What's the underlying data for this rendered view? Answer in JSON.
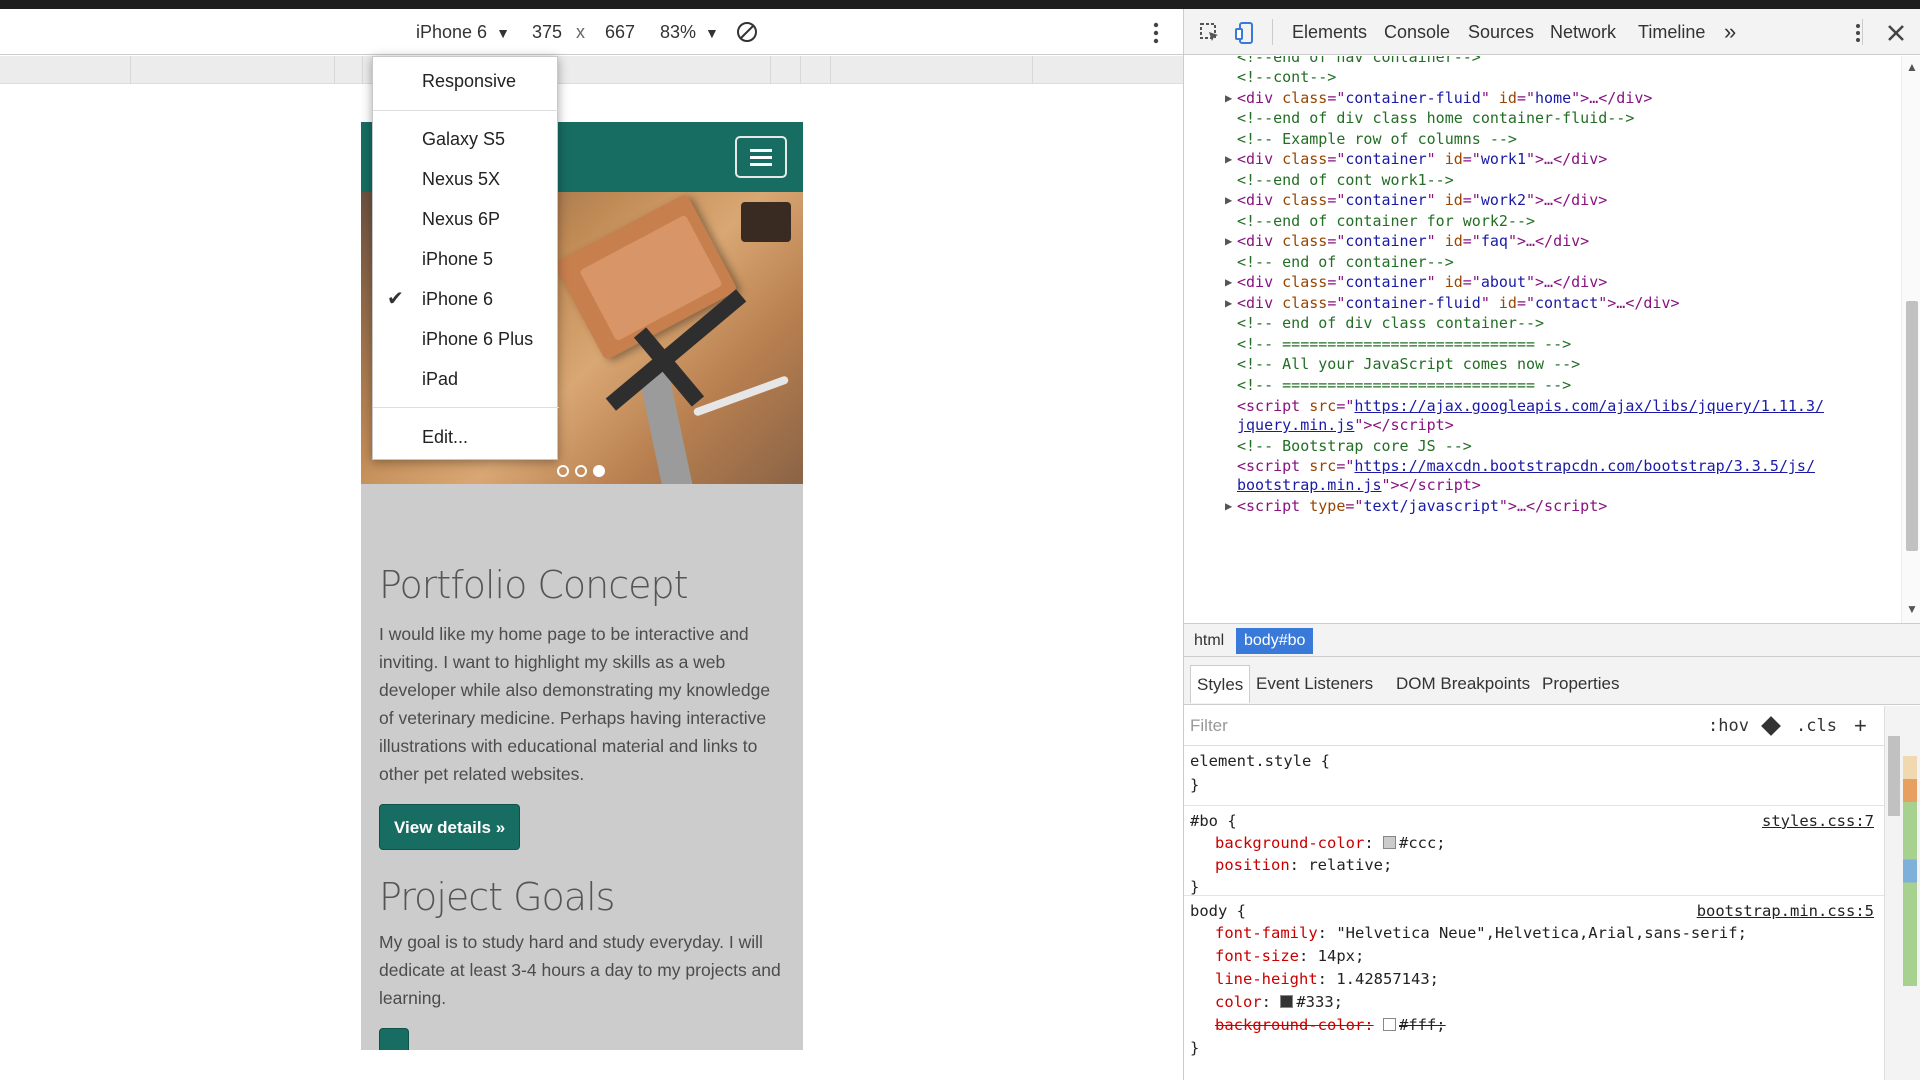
{
  "device_toolbar": {
    "device": "iPhone 6",
    "caret": "▼",
    "width": "375",
    "times": "x",
    "height": "667",
    "zoom": "83%"
  },
  "device_menu": {
    "items": [
      "Responsive",
      "Galaxy S5",
      "Nexus 5X",
      "Nexus 6P",
      "iPhone 5",
      "iPhone 6",
      "iPhone 6 Plus",
      "iPad",
      "Edit..."
    ],
    "selected": "iPhone 6",
    "check": "✔"
  },
  "page": {
    "section1_title": "Portfolio Concept",
    "section1_text": "I would like my home page to be interactive and inviting. I want to highlight my skills as a web developer while also demonstrating my knowledge of veterinary medicine. Perhaps having interactive illustrations with educational material and links to other pet related websites.",
    "button_label": "View details »",
    "section2_title": "Project Goals",
    "section2_text": "My goal is to study hard and study everyday. I will dedicate at least 3-4 hours a day to my projects and learning."
  },
  "devtools": {
    "tabs": [
      "Elements",
      "Console",
      "Sources",
      "Network",
      "Timeline"
    ],
    "more": "»",
    "breadcrumbs": [
      "html",
      "body#bo"
    ],
    "style_tabs": [
      "Styles",
      "Event Listeners",
      "DOM Breakpoints",
      "Properties"
    ],
    "filter_placeholder": "Filter",
    "hov": ":hov",
    "cls": ".cls",
    "plus": "+",
    "dom": {
      "l0": "<!--end of nav container-->",
      "l1": "<!--cont-->",
      "l2_id": "home",
      "l2_class": "container-fluid",
      "l3": "<!--end of div class home container-fluid-->",
      "l4": "<!-- Example row of columns -->",
      "l5_class": "container",
      "l5_id": "work1",
      "l6": "<!--end of cont work1-->",
      "l7_id": "work2",
      "l8": "<!--end of container for work2-->",
      "l9_id": "faq",
      "l10": "<!-- end of container-->",
      "l11_id": "about",
      "l12_id": "contact",
      "l13": "<!-- end of div class container-->",
      "l14": "<!-- ============================ -->",
      "l15": "<!-- All your JavaScript comes now -->",
      "l16": "<!-- ============================ -->",
      "l17_link_a": "https://ajax.googleapis.com/ajax/libs/jquery/1.11.3/",
      "l17_link_b": "jquery.min.js",
      "l18": "<!-- Bootstrap core JS -->",
      "l19_link_a": "https://maxcdn.bootstrapcdn.com/bootstrap/3.3.5/js/",
      "l19_link_b": "bootstrap.min.js",
      "l20_type": "text/javascript"
    },
    "rules": {
      "element_style": "element.style {",
      "bo_selector": "#bo {",
      "bo_source": "styles.css:7",
      "bo_bg_name": "background-color",
      "bo_bg_value": "#ccc;",
      "bo_pos_name": "position",
      "bo_pos_value": "relative;",
      "body_selector": "body {",
      "body_source": "bootstrap.min.css:5",
      "ff_name": "font-family",
      "ff_value": "\"Helvetica Neue\",Helvetica,Arial,sans-serif;",
      "fs_name": "font-size",
      "fs_value": "14px;",
      "lh_name": "line-height",
      "lh_value": "1.42857143;",
      "color_name": "color",
      "color_value": "#333;",
      "bgc_struck": "background-color:",
      "bgc_struck_value": "#fff;"
    }
  },
  "colors": {
    "nav_teal": "#176d62",
    "page_bg": "#cccccc",
    "selected_crumb": "#3879d9"
  }
}
